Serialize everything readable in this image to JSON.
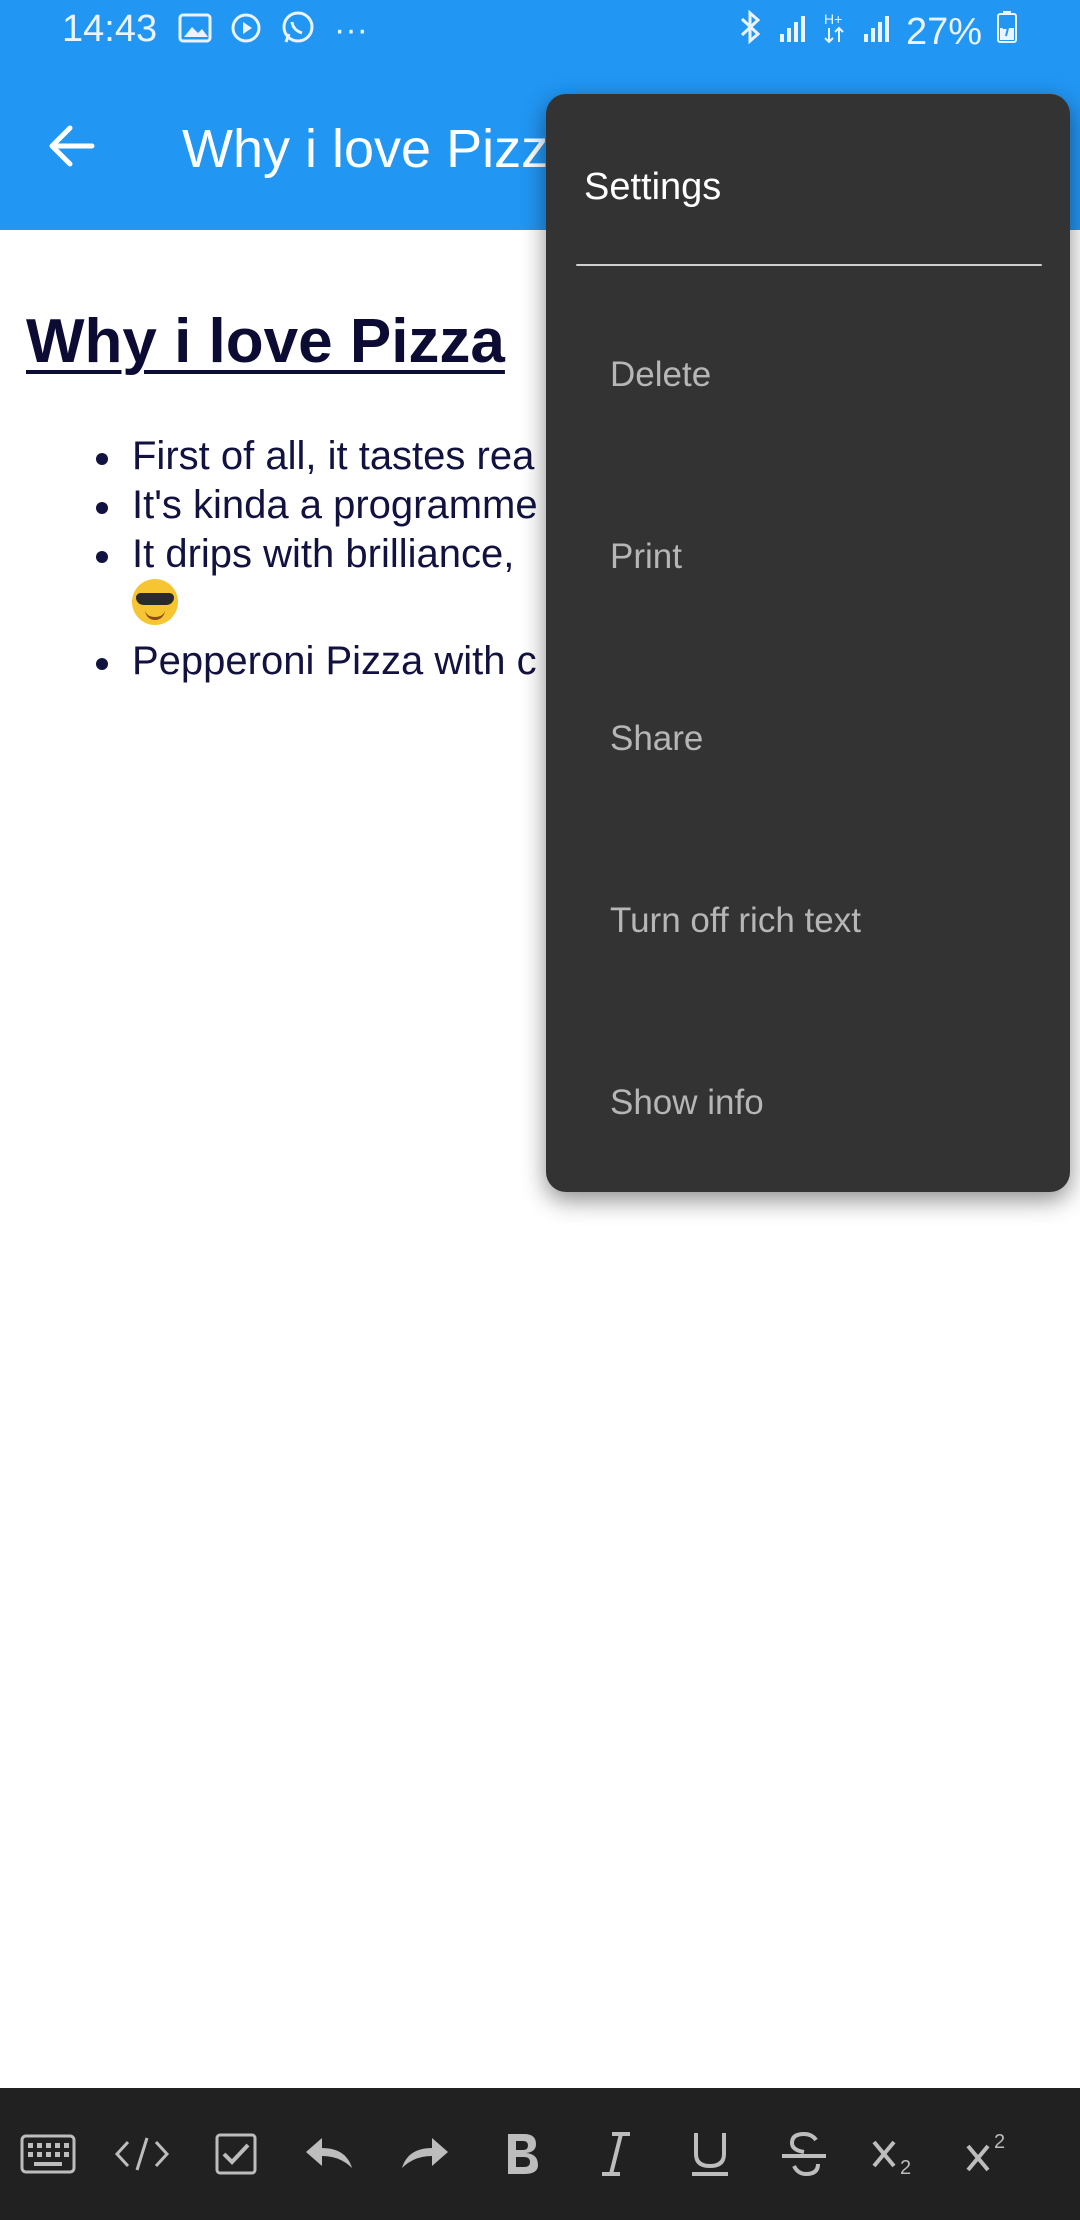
{
  "status_bar": {
    "time": "14:43",
    "left_icons": [
      "image-icon",
      "play-icon",
      "whatsapp-icon",
      "more-dots-icon"
    ],
    "right_icons": [
      "bluetooth-icon",
      "signal-icon",
      "data-hplus-icon",
      "signal-icon"
    ],
    "battery": "27%"
  },
  "app_bar": {
    "title": "Why i love Pizza",
    "color": "#2196F3"
  },
  "document": {
    "title": "Why i love Pizza",
    "bullets": [
      "First of all, it tastes rea",
      "It's kinda a programme",
      "It drips with brilliance,",
      "Pepperoni Pizza with c"
    ]
  },
  "menu": {
    "header": "Settings",
    "items": [
      "Delete",
      "Print",
      "Share",
      "Turn off rich text",
      "Show info"
    ],
    "background": "#333333"
  },
  "format_bar": {
    "buttons": [
      "keyboard-icon",
      "code-icon",
      "checkbox-icon",
      "undo-icon",
      "redo-icon",
      "bold-icon",
      "italic-icon",
      "underline-icon",
      "strikethrough-icon",
      "subscript-icon",
      "superscript-icon"
    ]
  }
}
